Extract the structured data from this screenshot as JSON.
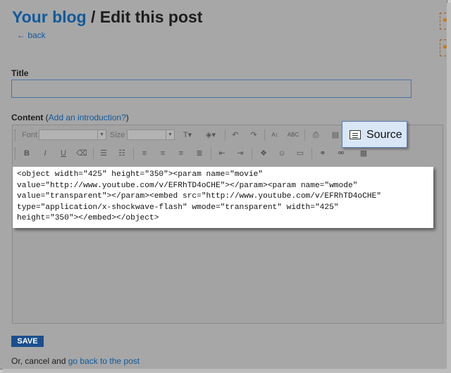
{
  "header": {
    "blog_link": "Your blog",
    "separator_title": " / Edit this post",
    "back_link": "← back"
  },
  "title_field": {
    "label": "Title",
    "value": ""
  },
  "content": {
    "label": "Content",
    "intro_link": "Add an introduction?",
    "open_paren": " (",
    "close_paren": ")"
  },
  "toolbar": {
    "font_label": "Font",
    "size_label": "Size",
    "source_label": "Source"
  },
  "code": {
    "lines": [
      "<object width=\"425\" height=\"350\"><param name=\"movie\"",
      "value=\"http://www.youtube.com/v/EFRhTD4oCHE\"></param><param name=\"wmode\"",
      "value=\"transparent\"></param><embed src=\"http://www.youtube.com/v/EFRhTD4oCHE\"",
      "type=\"application/x-shockwave-flash\" wmode=\"transparent\" width=\"425\"",
      "height=\"350\"></embed></object>"
    ]
  },
  "actions": {
    "save_label": "SAVE",
    "cancel_prefix": "Or, cancel and ",
    "cancel_link": "go back to the post"
  },
  "colors": {
    "link": "#0f5a9c",
    "save_bg": "#1c4f8d",
    "popup_bg": "#d9e6f6"
  }
}
